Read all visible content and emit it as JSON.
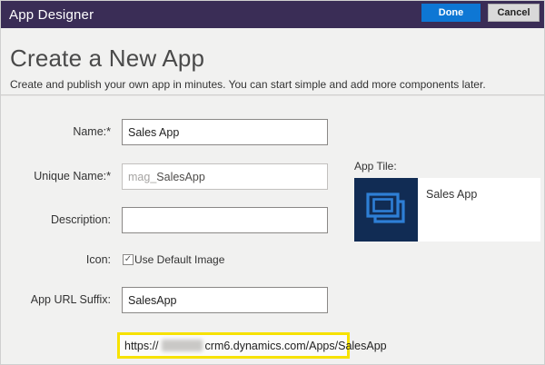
{
  "header": {
    "title": "App Designer",
    "done_label": "Done",
    "cancel_label": "Cancel"
  },
  "page": {
    "title": "Create a New App",
    "subtitle": "Create and publish your own app in minutes. You can start simple and add more components later."
  },
  "form": {
    "name": {
      "label": "Name:*",
      "value": "Sales App"
    },
    "unique_name": {
      "label": "Unique Name:*",
      "prefix": "mag_",
      "value": "SalesApp"
    },
    "description": {
      "label": "Description:",
      "value": ""
    },
    "icon": {
      "label": "Icon:",
      "checkbox_label": "Use Default Image",
      "checked": true,
      "check_glyph": "✓"
    },
    "url_suffix": {
      "label": "App URL Suffix:",
      "value": "SalesApp"
    },
    "url_preview": {
      "scheme": "https://",
      "redacted_org": true,
      "rest": "crm6.dynamics.com/Apps/SalesApp"
    }
  },
  "app_tile": {
    "label": "App Tile:",
    "name": "Sales App",
    "icon": "stacked-app-windows-icon"
  },
  "colors": {
    "header_bg": "#3a2d56",
    "done_bg": "#0e77d4",
    "tile_bg": "#112c54",
    "tile_icon": "#2e7fd6",
    "highlight_border": "#f7e200",
    "body_bg": "#f1f1f0"
  }
}
